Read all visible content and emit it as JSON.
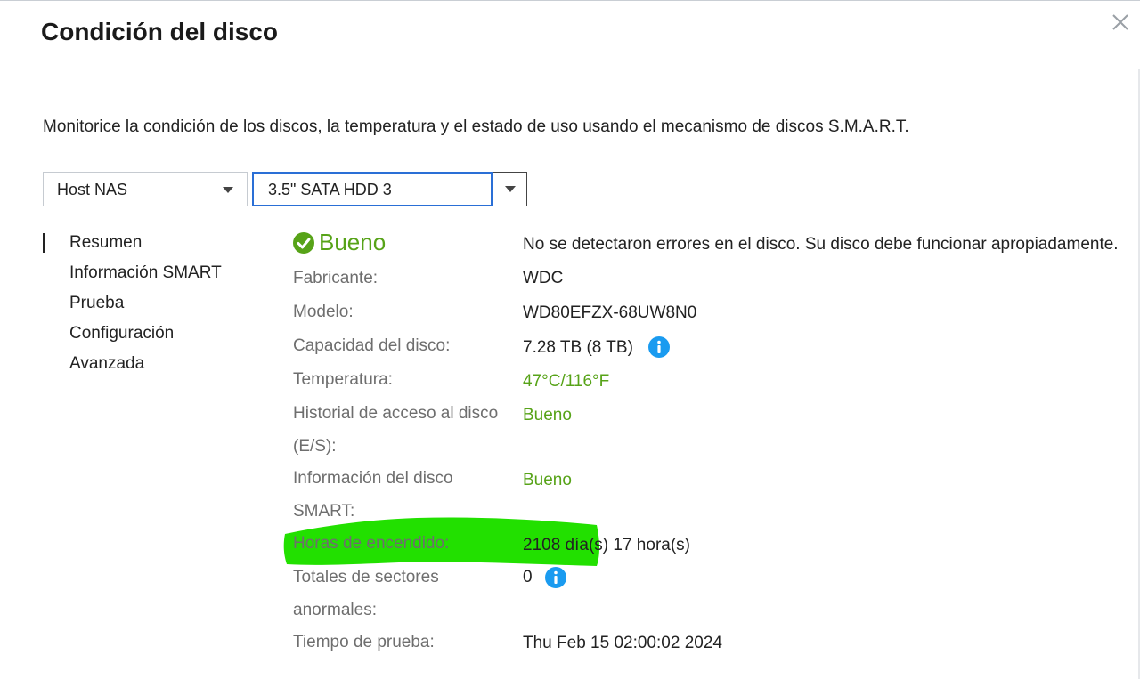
{
  "dialog": {
    "title": "Condición del disco",
    "description": "Monitorice la condición de los discos, la temperatura y el estado de uso usando el mecanismo de discos S.M.A.R.T."
  },
  "selectors": {
    "host": "Host NAS",
    "disk": "3.5\" SATA HDD 3"
  },
  "nav": {
    "items": [
      {
        "label": "Resumen",
        "active": true
      },
      {
        "label": "Información SMART",
        "active": false
      },
      {
        "label": "Prueba",
        "active": false
      },
      {
        "label": "Configuración",
        "active": false
      },
      {
        "label": "Avanzada",
        "active": false
      }
    ]
  },
  "summary": {
    "status": "Bueno",
    "status_message": "No se detectaron errores en el disco. Su disco debe funcionar apropiadamente.",
    "rows": [
      {
        "label": "Fabricante:",
        "value": "WDC"
      },
      {
        "label": "Modelo:",
        "value": "WD80EFZX-68UW8N0"
      },
      {
        "label": "Capacidad del disco:",
        "value": "7.28 TB (8 TB)"
      },
      {
        "label": "Temperatura:",
        "value": "47°C/116°F"
      },
      {
        "label": "Historial de acceso al disco (E/S):",
        "value": "Bueno"
      },
      {
        "label": "Información del disco SMART:",
        "value": "Bueno"
      },
      {
        "label": "Horas de encendido:",
        "value": "2108 día(s) 17 hora(s)"
      },
      {
        "label": "Totales de sectores anormales:",
        "value": "0"
      },
      {
        "label": "Tiempo de prueba:",
        "value": "Thu Feb 15 02:00:02 2024"
      }
    ]
  },
  "colors": {
    "good": "#57a318",
    "info": "#1a9bf0",
    "highlight": "#22e000",
    "focus": "#2a6fd6"
  },
  "icons": {
    "close": "close-icon",
    "status": "check-circle-icon",
    "info": "info-icon",
    "dropdown": "chevron-down-icon"
  }
}
